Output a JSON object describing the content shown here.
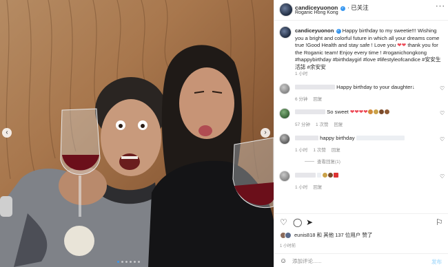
{
  "header": {
    "username": "candiceyuonon",
    "follow_status": "· 已关注",
    "location": "Roganic Hong Kong",
    "more": "···"
  },
  "caption": {
    "username": "candiceyuonon",
    "text_1": "Happy birthday to my sweetie!!! Wishing you a bright and colorful future in which all your dreams come true !Good Health and stay safe ! Love you",
    "text_2": "thank you for the Roganic team! Enjoy every time ! #roganichongkong #happybirthday #birthdaygirl #love #lifestyleofcandice #安安生活誌 #余安安",
    "time": "1 小时"
  },
  "comments": [
    {
      "text": "Happy birthday to your daughter",
      "time": "6 分钟",
      "reply": "回复"
    },
    {
      "text": "So sweet",
      "time": "57 分钟",
      "likes": "1 次赞",
      "reply": "回复"
    },
    {
      "text": "happy birthday",
      "time": "1 小时",
      "likes": "1 次赞",
      "reply": "回复",
      "view_replies": "查看回复(1)"
    },
    {
      "text": "",
      "time": "1 小时",
      "reply": "回复"
    }
  ],
  "likes": {
    "text": "eunis818 和 其他 137 位用户 赞了"
  },
  "post_time": "1 小时前",
  "add_comment": {
    "placeholder": "添加评论......",
    "post": "发布"
  },
  "icons": {
    "heart": "heart-icon",
    "comment": "comment-icon",
    "share": "share-icon",
    "save": "bookmark-icon",
    "emoji": "emoji-icon",
    "more": "more-options-icon"
  },
  "colors": {
    "accent": "#3897f0",
    "heart_red": "#ed4956"
  }
}
